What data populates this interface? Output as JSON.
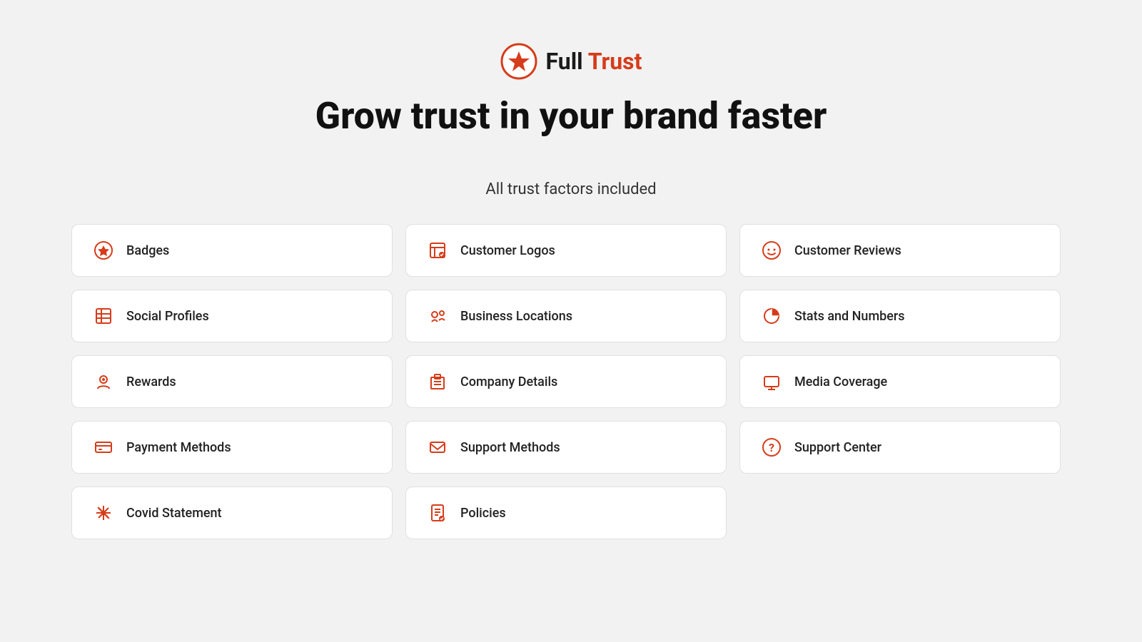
{
  "brand": {
    "name_full": "Full",
    "name_trust": "Trust",
    "tagline": "Grow trust in your brand faster",
    "subtitle": "All trust factors included"
  },
  "colors": {
    "accent": "#d63c1a",
    "text_dark": "#111"
  },
  "grid": {
    "columns": [
      [
        {
          "id": "badges",
          "label": "Badges",
          "icon": "✳"
        },
        {
          "id": "social-profiles",
          "label": "Social Profiles",
          "icon": "🔲"
        },
        {
          "id": "rewards",
          "label": "Rewards",
          "icon": "👤"
        },
        {
          "id": "payment-methods",
          "label": "Payment Methods",
          "icon": "💳"
        },
        {
          "id": "covid-statement",
          "label": "Covid Statement",
          "icon": "✳"
        }
      ],
      [
        {
          "id": "customer-logos",
          "label": "Customer Logos",
          "icon": "📄"
        },
        {
          "id": "business-locations",
          "label": "Business Locations",
          "icon": "👥"
        },
        {
          "id": "company-details",
          "label": "Company Details",
          "icon": "🏢"
        },
        {
          "id": "support-methods",
          "label": "Support Methods",
          "icon": "✉"
        },
        {
          "id": "policies",
          "label": "Policies",
          "icon": "📄"
        }
      ],
      [
        {
          "id": "customer-reviews",
          "label": "Customer Reviews",
          "icon": "😊"
        },
        {
          "id": "stats-and-numbers",
          "label": "Stats and Numbers",
          "icon": "📊"
        },
        {
          "id": "media-coverage",
          "label": "Media Coverage",
          "icon": "🖥"
        },
        {
          "id": "support-center",
          "label": "Support Center",
          "icon": "❓"
        }
      ]
    ]
  }
}
